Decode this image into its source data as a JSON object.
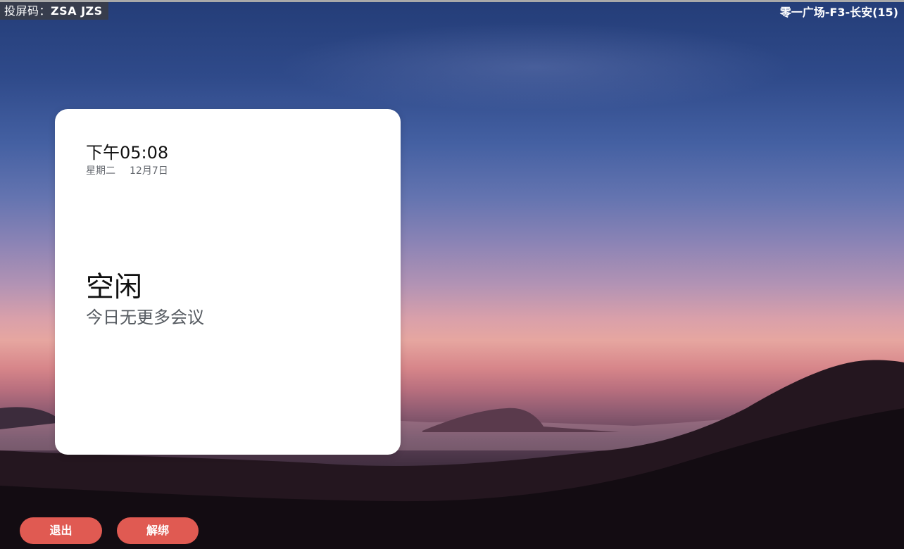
{
  "topbar": {
    "cast_code_label": "投屏码：",
    "cast_code_value": "ZSA JZS",
    "room_name": "零一广场-F3-长安(15)"
  },
  "card": {
    "time": "下午05:08",
    "weekday": "星期二",
    "date": "12月7日",
    "status": "空闲",
    "status_detail": "今日无更多会议"
  },
  "actions": {
    "exit_label": "退出",
    "unbind_label": "解绑"
  },
  "colors": {
    "button_bg": "#e05a52",
    "card_bg": "#ffffff"
  }
}
